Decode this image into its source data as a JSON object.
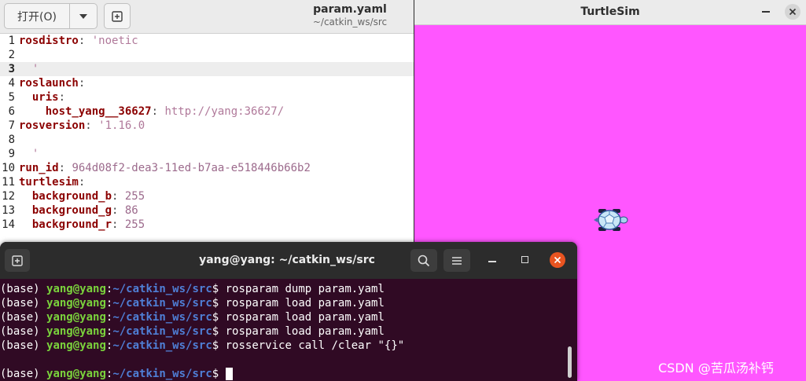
{
  "editor": {
    "open_button": "打开(O)",
    "file_name": "param.yaml",
    "file_path": "~/catkin_ws/src",
    "lines": [
      {
        "n": "1",
        "key": "rosdistro",
        "sep": ": ",
        "val": "'noetic",
        "vtype": "str"
      },
      {
        "n": "2",
        "key": "",
        "sep": "",
        "val": "",
        "vtype": "str"
      },
      {
        "n": "3",
        "key": "",
        "sep": "",
        "val": "  '",
        "vtype": "str"
      },
      {
        "n": "4",
        "key": "roslaunch",
        "sep": ":",
        "val": "",
        "vtype": "str"
      },
      {
        "n": "5",
        "key": "  uris",
        "sep": ":",
        "val": "",
        "vtype": "str"
      },
      {
        "n": "6",
        "key": "    host_yang__36627",
        "sep": ": ",
        "val": "http://yang:36627/",
        "vtype": "str"
      },
      {
        "n": "7",
        "key": "rosversion",
        "sep": ": ",
        "val": "'1.16.0",
        "vtype": "str"
      },
      {
        "n": "8",
        "key": "",
        "sep": "",
        "val": "",
        "vtype": "str"
      },
      {
        "n": "9",
        "key": "",
        "sep": "",
        "val": "  '",
        "vtype": "str"
      },
      {
        "n": "10",
        "key": "run_id",
        "sep": ": ",
        "val": "964d08f2-dea3-11ed-b7aa-e518446b66b2",
        "vtype": "num"
      },
      {
        "n": "11",
        "key": "turtlesim",
        "sep": ":",
        "val": "",
        "vtype": "str"
      },
      {
        "n": "12",
        "key": "  background_b",
        "sep": ": ",
        "val": "255",
        "vtype": "num"
      },
      {
        "n": "13",
        "key": "  background_g",
        "sep": ": ",
        "val": "86",
        "vtype": "num"
      },
      {
        "n": "14",
        "key": "  background_r",
        "sep": ": ",
        "val": "255",
        "vtype": "num"
      }
    ],
    "current_line": 3
  },
  "turtlesim": {
    "title": "TurtleSim",
    "background_color": "#ff56ff",
    "watermark": "CSDN @苦瓜汤补钙"
  },
  "terminal": {
    "title": "yang@yang: ~/catkin_ws/src",
    "lines": [
      {
        "env": "(base) ",
        "user": "yang@yang",
        "colon": ":",
        "path": "~/catkin_ws/src",
        "dollar": "$ ",
        "cmd": "rosparam dump param.yaml"
      },
      {
        "env": "(base) ",
        "user": "yang@yang",
        "colon": ":",
        "path": "~/catkin_ws/src",
        "dollar": "$ ",
        "cmd": "rosparam load param.yaml"
      },
      {
        "env": "(base) ",
        "user": "yang@yang",
        "colon": ":",
        "path": "~/catkin_ws/src",
        "dollar": "$ ",
        "cmd": "rosparam load param.yaml"
      },
      {
        "env": "(base) ",
        "user": "yang@yang",
        "colon": ":",
        "path": "~/catkin_ws/src",
        "dollar": "$ ",
        "cmd": "rosparam load param.yaml"
      },
      {
        "env": "(base) ",
        "user": "yang@yang",
        "colon": ":",
        "path": "~/catkin_ws/src",
        "dollar": "$ ",
        "cmd": "rosservice call /clear \"{}\""
      },
      {
        "env": "",
        "user": "",
        "colon": "",
        "path": "",
        "dollar": "",
        "cmd": ""
      },
      {
        "env": "(base) ",
        "user": "yang@yang",
        "colon": ":",
        "path": "~/catkin_ws/src",
        "dollar": "$ ",
        "cmd": "",
        "cursor": true
      }
    ]
  },
  "icons": {
    "new_tab": "new-tab-icon",
    "dropdown": "chevron-down-icon",
    "search": "search-icon",
    "menu": "hamburger-menu-icon",
    "minimize": "minimize-icon",
    "maximize": "maximize-icon",
    "close": "close-icon",
    "turtle": "turtle-icon"
  }
}
